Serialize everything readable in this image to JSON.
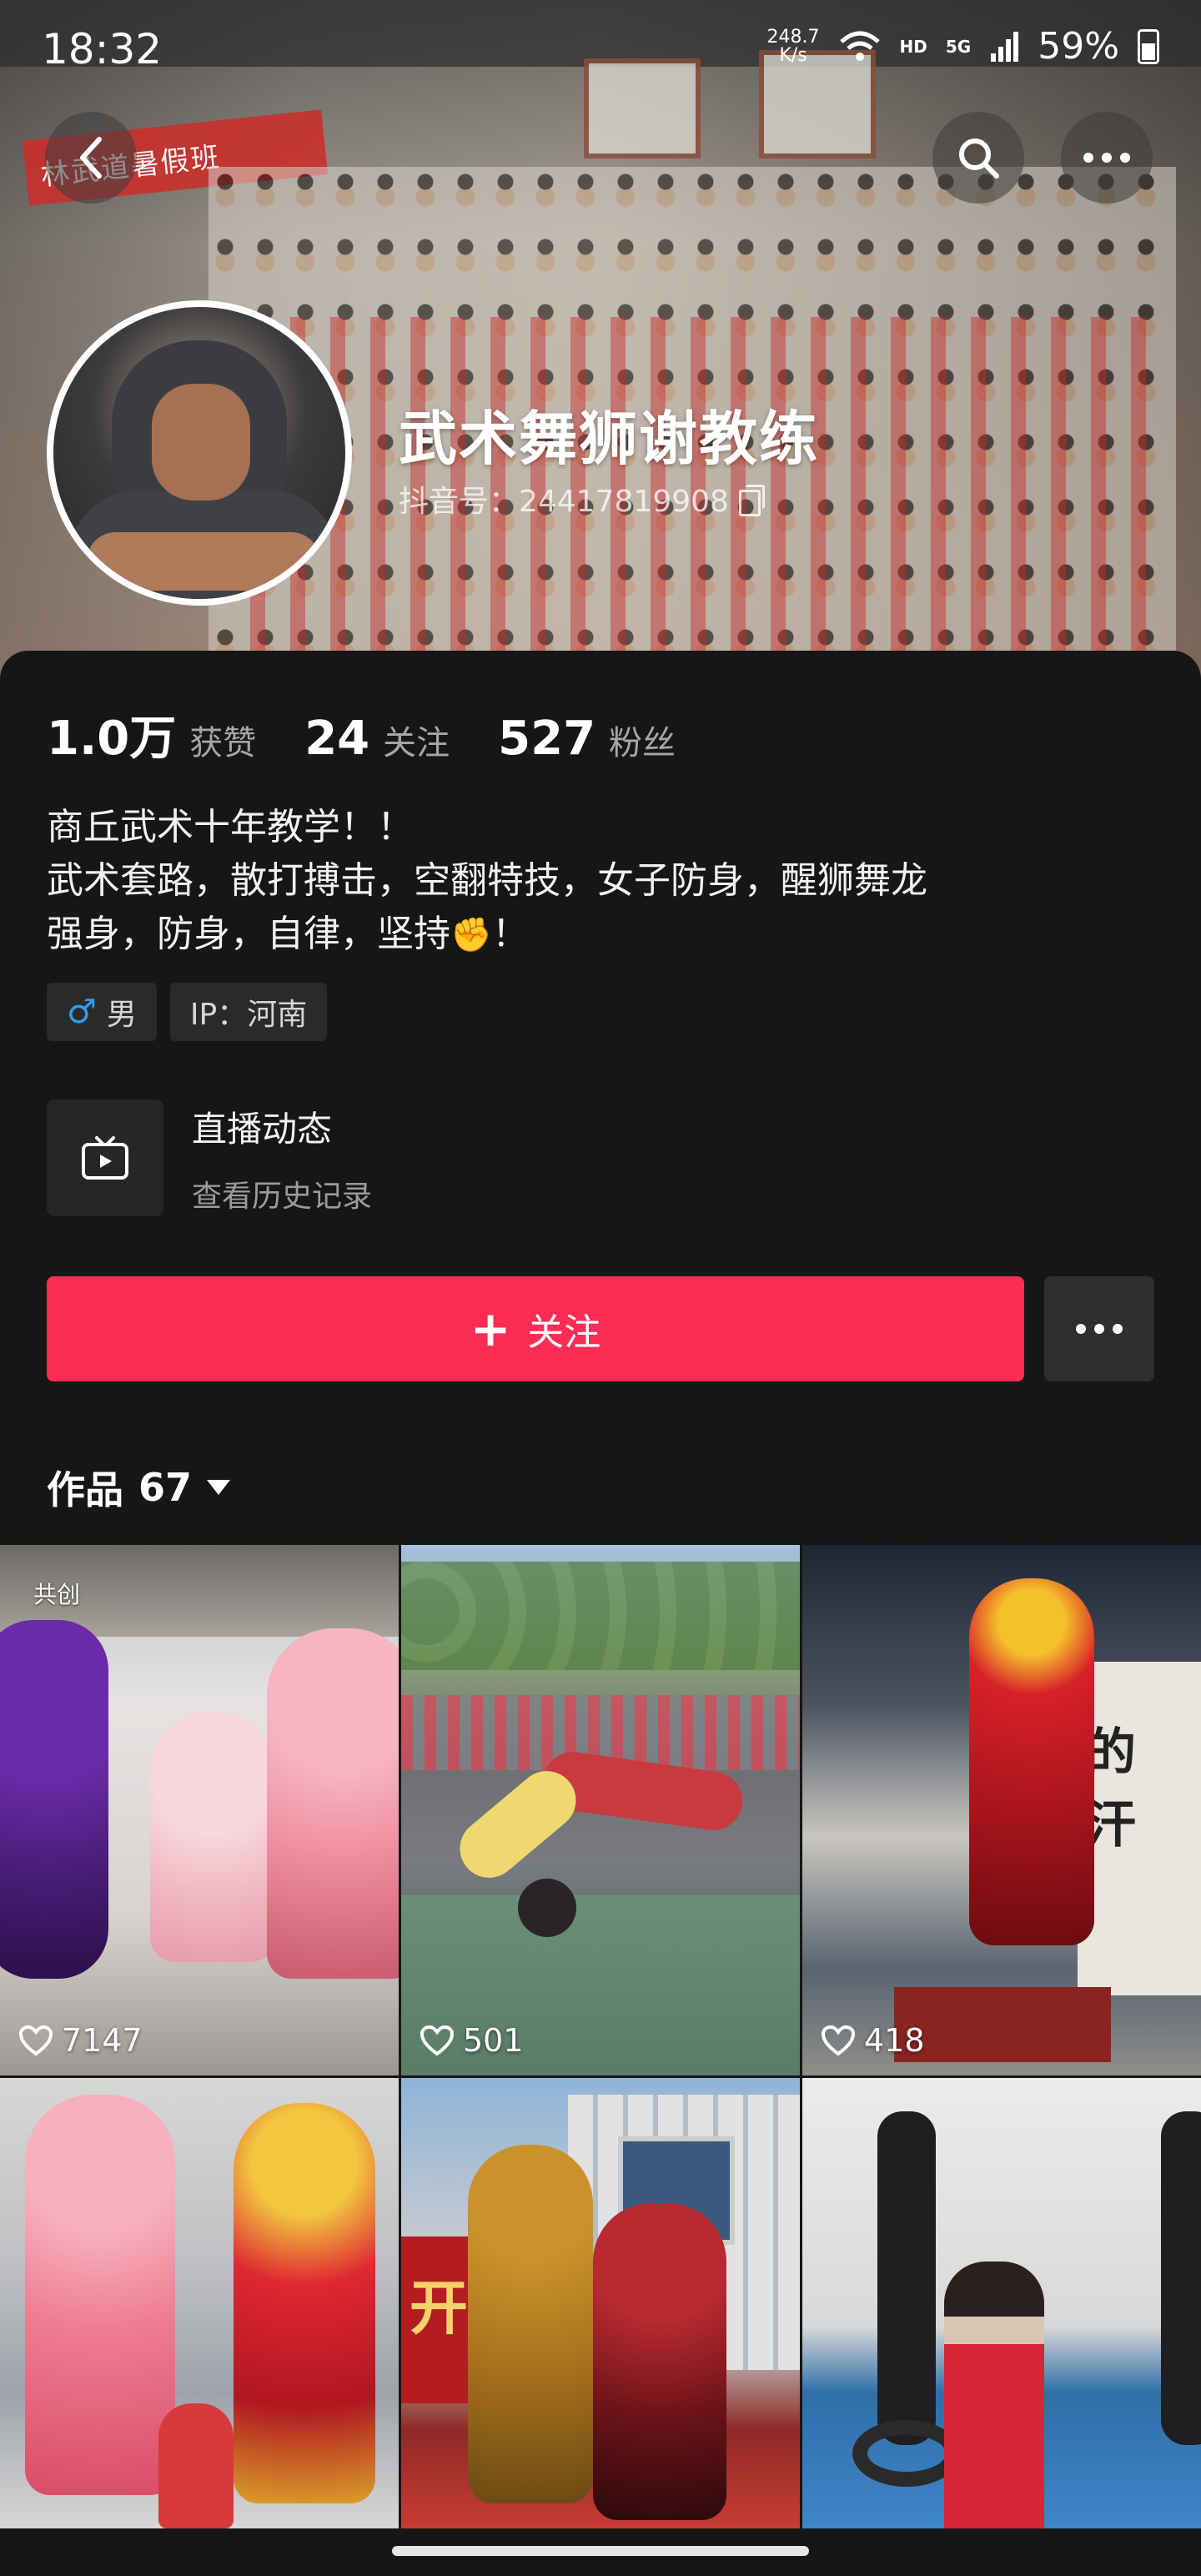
{
  "status_bar": {
    "time": "18:32",
    "net_speed_value": "248.7",
    "net_speed_unit": "K/s",
    "hd": "HD",
    "network": "5G",
    "battery": "59%"
  },
  "banner": {
    "red_banner_text": "林武道暑假班",
    "icons": {
      "back": "chevron-left-icon",
      "search": "search-icon",
      "more": "more-horizontal-icon"
    }
  },
  "profile": {
    "name": "武术舞狮谢教练",
    "douyin_id": "抖音号：24417819908"
  },
  "stats": [
    {
      "num": "1.0万",
      "label": "获赞"
    },
    {
      "num": "24",
      "label": "关注"
    },
    {
      "num": "527",
      "label": "粉丝"
    }
  ],
  "bio": {
    "line1": "商丘武术十年教学！！",
    "line2": "武术套路，散打搏击，空翻特技，女子防身，醒狮舞龙",
    "line3_a": "强身，防身，自律，坚持",
    "line3_emoji": "✊",
    "line3_b": "！"
  },
  "tags": {
    "gender_icon": "♂",
    "gender": "男",
    "ip": "IP：河南"
  },
  "live": {
    "title": "直播动态",
    "subtitle": "查看历史记录"
  },
  "actions": {
    "follow_plus": "+",
    "follow_label": "关注"
  },
  "works": {
    "label": "作品",
    "count": "67"
  },
  "grid": {
    "tile1_badge": "共创",
    "tile1_likes": "7147",
    "tile2_likes": "501",
    "tile3_likes": "418",
    "tile3_sign": "的 汗",
    "tile5_sign": "开"
  }
}
